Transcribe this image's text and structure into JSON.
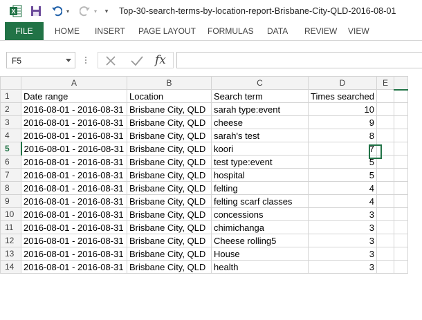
{
  "window": {
    "title": "Top-30-search-terms-by-location-report-Brisbane-City-QLD-2016-08-01"
  },
  "quick_access": {
    "excel_icon": "excel-icon",
    "save_icon": "save-icon",
    "undo_icon": "undo-icon",
    "redo_icon": "redo-icon",
    "customize_icon": "customize-icon"
  },
  "ribbon": {
    "file_label": "FILE",
    "tabs": [
      "HOME",
      "INSERT",
      "PAGE LAYOUT",
      "FORMULAS",
      "DATA",
      "REVIEW",
      "VIEW"
    ],
    "accent": "#217346"
  },
  "formula_bar": {
    "name_box": "F5",
    "cancel_icon": "cancel-icon",
    "enter_icon": "enter-icon",
    "fx_label": "fx",
    "formula_value": ""
  },
  "sheet": {
    "columns": [
      "A",
      "B",
      "C",
      "D",
      "E"
    ],
    "header_row": [
      "Date range",
      "Location",
      "Search term",
      "Times searched"
    ],
    "rows": [
      {
        "num": "2",
        "date": "2016-08-01 - 2016-08-31",
        "loc": "Brisbane City, QLD",
        "term": "sarah type:event",
        "times": "10"
      },
      {
        "num": "3",
        "date": "2016-08-01 - 2016-08-31",
        "loc": "Brisbane City, QLD",
        "term": "cheese",
        "times": "9"
      },
      {
        "num": "4",
        "date": "2016-08-01 - 2016-08-31",
        "loc": "Brisbane City, QLD",
        "term": "sarah's test",
        "times": "8"
      },
      {
        "num": "5",
        "date": "2016-08-01 - 2016-08-31",
        "loc": "Brisbane City, QLD",
        "term": "koori",
        "times": "7"
      },
      {
        "num": "6",
        "date": "2016-08-01 - 2016-08-31",
        "loc": "Brisbane City, QLD",
        "term": "test type:event",
        "times": "5"
      },
      {
        "num": "7",
        "date": "2016-08-01 - 2016-08-31",
        "loc": "Brisbane City, QLD",
        "term": "hospital",
        "times": "5"
      },
      {
        "num": "8",
        "date": "2016-08-01 - 2016-08-31",
        "loc": "Brisbane City, QLD",
        "term": "felting",
        "times": "4"
      },
      {
        "num": "9",
        "date": "2016-08-01 - 2016-08-31",
        "loc": "Brisbane City, QLD",
        "term": "felting scarf classes",
        "times": "4"
      },
      {
        "num": "10",
        "date": "2016-08-01 - 2016-08-31",
        "loc": "Brisbane City, QLD",
        "term": "concessions",
        "times": "3"
      },
      {
        "num": "11",
        "date": "2016-08-01 - 2016-08-31",
        "loc": "Brisbane City, QLD",
        "term": "chimichanga",
        "times": "3"
      },
      {
        "num": "12",
        "date": "2016-08-01 - 2016-08-31",
        "loc": "Brisbane City, QLD",
        "term": "Cheese rolling5",
        "times": "3"
      },
      {
        "num": "13",
        "date": "2016-08-01 - 2016-08-31",
        "loc": "Brisbane City, QLD",
        "term": "House",
        "times": "3"
      },
      {
        "num": "14",
        "date": "2016-08-01 - 2016-08-31",
        "loc": "Brisbane City, QLD",
        "term": "health",
        "times": "3"
      }
    ],
    "active_row": "5"
  }
}
